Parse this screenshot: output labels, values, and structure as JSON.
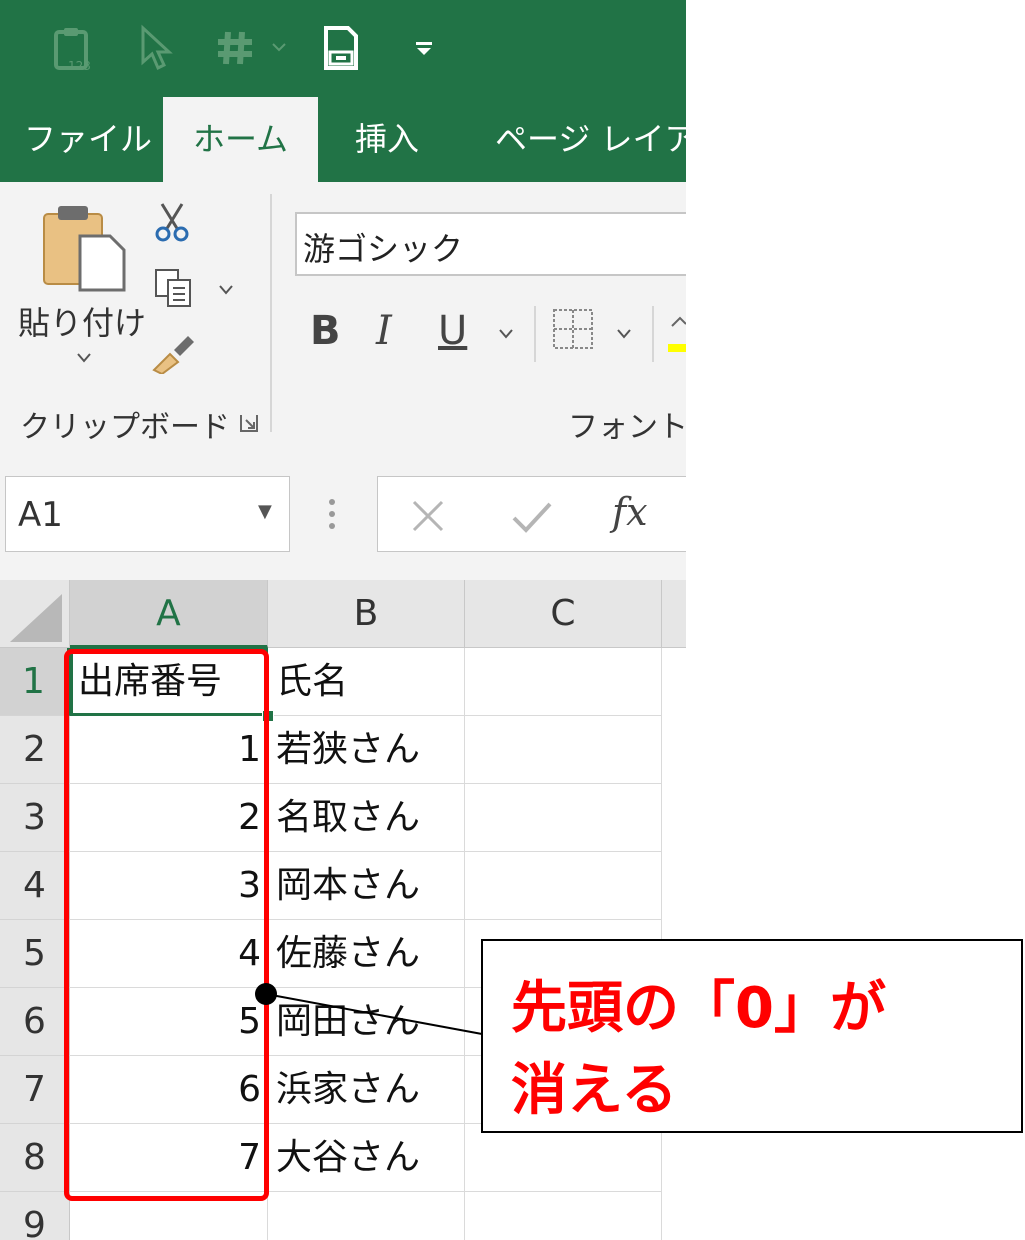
{
  "ribbon": {
    "tabs": [
      "ファイル",
      "ホーム",
      "挿入",
      "ページ レイアウ"
    ],
    "active_tab": "ホーム",
    "clipboard": {
      "paste_label": "貼り付け",
      "group_label": "クリップボード"
    },
    "font": {
      "font_name": "游ゴシック",
      "group_label": "フォント",
      "bold": "B",
      "italic": "I",
      "underline": "U"
    }
  },
  "formula_bar": {
    "name_box": "A1",
    "fx": "fx"
  },
  "sheet": {
    "columns": [
      "A",
      "B",
      "C"
    ],
    "rows": [
      {
        "num": "1",
        "a": "出席番号",
        "b": "氏名"
      },
      {
        "num": "2",
        "a": "1",
        "b": "若狭さん"
      },
      {
        "num": "3",
        "a": "2",
        "b": "名取さん"
      },
      {
        "num": "4",
        "a": "3",
        "b": "岡本さん"
      },
      {
        "num": "5",
        "a": "4",
        "b": "佐藤さん"
      },
      {
        "num": "6",
        "a": "5",
        "b": "岡田さん"
      },
      {
        "num": "7",
        "a": "6",
        "b": "浜家さん"
      },
      {
        "num": "8",
        "a": "7",
        "b": "大谷さん"
      },
      {
        "num": "9",
        "a": "",
        "b": ""
      }
    ]
  },
  "annotation": {
    "line1": "先頭の「0」が",
    "line2": "消える"
  },
  "colors": {
    "excel_green": "#217346",
    "highlight_red": "#ff0000"
  }
}
